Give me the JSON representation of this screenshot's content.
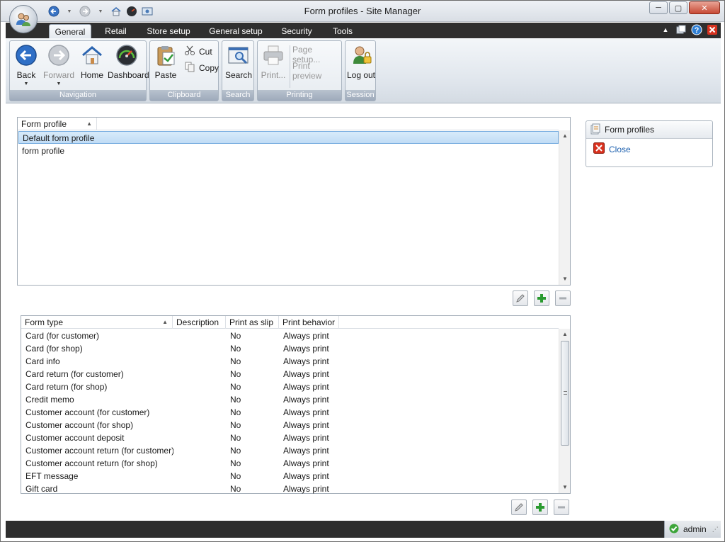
{
  "window": {
    "title": "Form profiles - Site Manager"
  },
  "tabs": [
    "General",
    "Retail",
    "Store setup",
    "General setup",
    "Security",
    "Tools"
  ],
  "active_tab": "General",
  "ribbon": {
    "navigation": {
      "label": "Navigation",
      "back": "Back",
      "forward": "Forward",
      "home": "Home",
      "dashboard": "Dashboard"
    },
    "clipboard": {
      "label": "Clipboard",
      "paste": "Paste",
      "cut": "Cut",
      "copy": "Copy"
    },
    "search": {
      "label": "Search",
      "search": "Search"
    },
    "printing": {
      "label": "Printing",
      "print": "Print...",
      "page_setup": "Page setup...",
      "print_preview": "Print preview"
    },
    "session": {
      "label": "Session",
      "logout": "Log out"
    }
  },
  "profiles_grid": {
    "column": "Form profile",
    "rows": [
      "Default form profile",
      "form profile"
    ],
    "selected_index": 0
  },
  "forms_grid": {
    "columns": [
      "Form type",
      "Description",
      "Print as slip",
      "Print behavior"
    ],
    "rows": [
      {
        "form_type": "Card (for customer)",
        "description": "",
        "print_as_slip": "No",
        "print_behavior": "Always print"
      },
      {
        "form_type": "Card (for shop)",
        "description": "",
        "print_as_slip": "No",
        "print_behavior": "Always print"
      },
      {
        "form_type": "Card info",
        "description": "",
        "print_as_slip": "No",
        "print_behavior": "Always print"
      },
      {
        "form_type": "Card return (for customer)",
        "description": "",
        "print_as_slip": "No",
        "print_behavior": "Always print"
      },
      {
        "form_type": "Card return (for shop)",
        "description": "",
        "print_as_slip": "No",
        "print_behavior": "Always print"
      },
      {
        "form_type": "Credit memo",
        "description": "",
        "print_as_slip": "No",
        "print_behavior": "Always print"
      },
      {
        "form_type": "Customer account (for customer)",
        "description": "",
        "print_as_slip": "No",
        "print_behavior": "Always print"
      },
      {
        "form_type": "Customer account (for shop)",
        "description": "",
        "print_as_slip": "No",
        "print_behavior": "Always print"
      },
      {
        "form_type": "Customer account deposit",
        "description": "",
        "print_as_slip": "No",
        "print_behavior": "Always print"
      },
      {
        "form_type": "Customer account return (for customer)",
        "description": "",
        "print_as_slip": "No",
        "print_behavior": "Always print"
      },
      {
        "form_type": "Customer account return (for shop)",
        "description": "",
        "print_as_slip": "No",
        "print_behavior": "Always print"
      },
      {
        "form_type": "EFT message",
        "description": "",
        "print_as_slip": "No",
        "print_behavior": "Always print"
      },
      {
        "form_type": "Gift card",
        "description": "",
        "print_as_slip": "No",
        "print_behavior": "Always print"
      }
    ]
  },
  "side_panel": {
    "title": "Form profiles",
    "close_link": "Close"
  },
  "status": {
    "user": "admin"
  }
}
